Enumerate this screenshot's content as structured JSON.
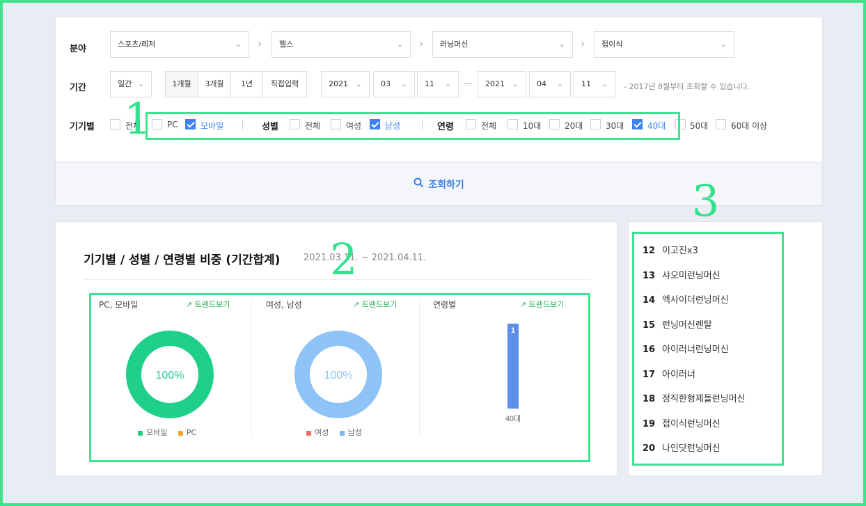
{
  "filter": {
    "field_label": "분야",
    "categories": [
      "스포츠/레저",
      "헬스",
      "러닝머신",
      "접이식"
    ],
    "period_label": "기간",
    "period_unit": "일간",
    "period_buttons": [
      "1개월",
      "3개월",
      "1년",
      "직접입력"
    ],
    "start": {
      "year": "2021",
      "month": "03",
      "day": "11"
    },
    "end": {
      "year": "2021",
      "month": "04",
      "day": "11"
    },
    "period_note": "- 2017년 8월부터 조회할 수 있습니다.",
    "device_label": "기기별",
    "device_options": [
      {
        "label": "전체",
        "checked": false
      },
      {
        "label": "PC",
        "checked": false
      },
      {
        "label": "모바일",
        "checked": true
      }
    ],
    "gender_label": "성별",
    "gender_options": [
      {
        "label": "전체",
        "checked": false
      },
      {
        "label": "여성",
        "checked": false
      },
      {
        "label": "남성",
        "checked": true
      }
    ],
    "age_label": "연령",
    "age_options": [
      {
        "label": "전체",
        "checked": false
      },
      {
        "label": "10대",
        "checked": false
      },
      {
        "label": "20대",
        "checked": false
      },
      {
        "label": "30대",
        "checked": false
      },
      {
        "label": "40대",
        "checked": true
      },
      {
        "label": "50대",
        "checked": false
      },
      {
        "label": "60대 이상",
        "checked": false
      }
    ],
    "search_label": "조회하기"
  },
  "chart_section": {
    "title": "기기별 / 성별 / 연령별 비중 (기간합계)",
    "date_range": "2021.03.11. ~ 2021.04.11.",
    "trend_label": "트렌드보기",
    "panels": [
      {
        "title": "PC, 모바일",
        "center_label": "100%",
        "legend": [
          {
            "name": "모바일",
            "color": "#1fd08a"
          },
          {
            "name": "PC",
            "color": "#f5a623"
          }
        ]
      },
      {
        "title": "여성, 남성",
        "center_label": "100%",
        "legend": [
          {
            "name": "여성",
            "color": "#f06b6b"
          },
          {
            "name": "남성",
            "color": "#7db8f5"
          }
        ]
      },
      {
        "title": "연령별"
      }
    ]
  },
  "chart_data": [
    {
      "type": "pie",
      "categories": [
        "모바일",
        "PC"
      ],
      "values": [
        100,
        0
      ]
    },
    {
      "type": "pie",
      "categories": [
        "여성",
        "남성"
      ],
      "values": [
        0,
        100
      ]
    },
    {
      "type": "bar",
      "categories": [
        "40대"
      ],
      "values": [
        1
      ],
      "data_labels": [
        "1"
      ]
    }
  ],
  "ranking": [
    {
      "rank": "12",
      "name": "이고진x3"
    },
    {
      "rank": "13",
      "name": "샤오미런닝머신"
    },
    {
      "rank": "14",
      "name": "엑사이더런닝머신"
    },
    {
      "rank": "15",
      "name": "런닝머신렌탈"
    },
    {
      "rank": "16",
      "name": "아이러너런닝머신"
    },
    {
      "rank": "17",
      "name": "아이러너"
    },
    {
      "rank": "18",
      "name": "정직한형제들런닝머신"
    },
    {
      "rank": "19",
      "name": "접이식런닝머신"
    },
    {
      "rank": "20",
      "name": "나인닷런닝머신"
    }
  ],
  "annotations": [
    "1",
    "2",
    "3"
  ],
  "colors": {
    "accent": "#3b82f6",
    "highlight": "#3fe38f",
    "trend": "#2cb35a"
  }
}
